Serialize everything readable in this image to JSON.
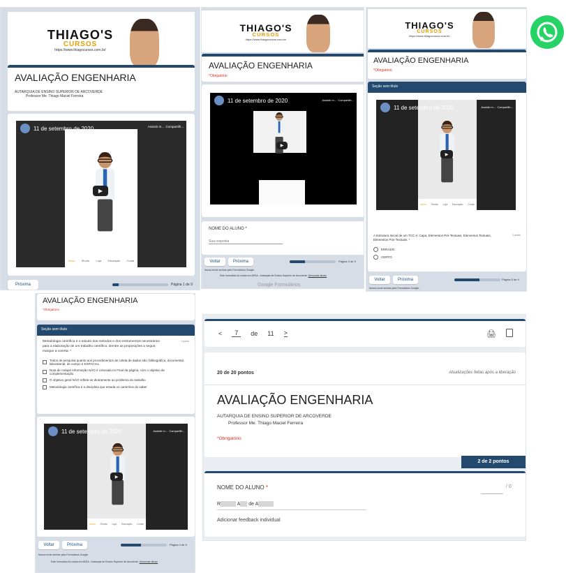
{
  "brand": {
    "logo": "THIAGO'S",
    "sub": "CURSOS",
    "url": "https://www.thiagocursos.com.br/"
  },
  "form": {
    "title": "AVALIAÇÃO ENGENHARIA",
    "institution": "AUTARQUIA DE ENSINO SUPERIOR DE ARCOVERDE",
    "professor": "Professor Me. Thiago Maciel Ferreira",
    "required": "*Obrigatório",
    "section_title": "Seção sem título"
  },
  "video": {
    "date": "11 de setembro de 2020",
    "watch_later": "Assistir m...",
    "share": "Compartilh...",
    "nav": [
      "Início",
      "Shorts",
      "Loja",
      "Educação",
      "Conta"
    ]
  },
  "panel1": {
    "next": "Próxima",
    "page": "Página 1 de 9",
    "progress": 0.11
  },
  "panel2": {
    "question": "NOME DO ALUNO *",
    "placeholder": "Sua resposta",
    "back": "Voltar",
    "next": "Próxima",
    "page": "Página 3 de 9",
    "progress": 0.33,
    "footer_note": "Nunca envie senhas pelo Formulários Google.",
    "footer_created": "Este formulário foi criado em AESA - Autarquia de Ensino Superior de Arcoverde.",
    "footer_report": "Denunciar abuso",
    "google": "Google Formulários"
  },
  "panel3": {
    "question": "A Estrutura Inicial de um TCC é: Capa, Elementos Pré-Textuais, Elementos Textuais, Elementos Pós-Textuais. *",
    "points": "1 ponto",
    "options": [
      "ERRADO",
      "CERTO"
    ],
    "back": "Voltar",
    "next": "Próxima",
    "page": "Página 5 de 9",
    "progress": 0.55,
    "footer_note": "Nunca envie senhas pelo Formulários Google."
  },
  "panel4": {
    "question": "Metodologia científica é o estudo dos métodos e dos instrumentos necessários para a elaboração de um trabalho científico. Dentre as proposições a seguir, marque a correta: *",
    "points": "1 ponto",
    "options": [
      "Todos de pesquisa quanto aos procedimentos de coleta de dados são: bibliográfica, documental, laboratorial, de campo e ESPACIAL",
      "Nota de rodapé Informação NÃO é colocada no Final da página, com o objetivo de complementação",
      "O objetivo geral NÃO reflete-se diretamente ao problema do trabalho",
      "Metodologia científica é a disciplina que estuda os caminhos do saber"
    ],
    "back": "Voltar",
    "next": "Próxima",
    "page": "Página 4 de 9",
    "progress": 0.44,
    "footer_note": "Nunca envie senhas pelo Formulários Google.",
    "footer_created": "Este formulário foi criado em AESA - Autarquia de Ensino Superior de Arcoverde.",
    "footer_report": "Denunciar abuso"
  },
  "panel5": {
    "prev_arrow": "<",
    "current": "7",
    "of": "de",
    "total": "11",
    "next_arrow": ">",
    "score": "20 de 20 pontos",
    "release_note": "Atualizações feitas após a liberação",
    "question_points": "2 de 2 pontos",
    "question": "NOME DO ALUNO",
    "question_star": "*",
    "max_score": "/ 0",
    "answer_a": "R",
    "answer_b": "A",
    "answer_c": "de A",
    "feedback": "Adicionar feedback individual"
  },
  "colors": {
    "accent": "#234a6e",
    "required": "#d93025",
    "whatsapp": "#25d366",
    "logo_orange": "#e69b00"
  }
}
